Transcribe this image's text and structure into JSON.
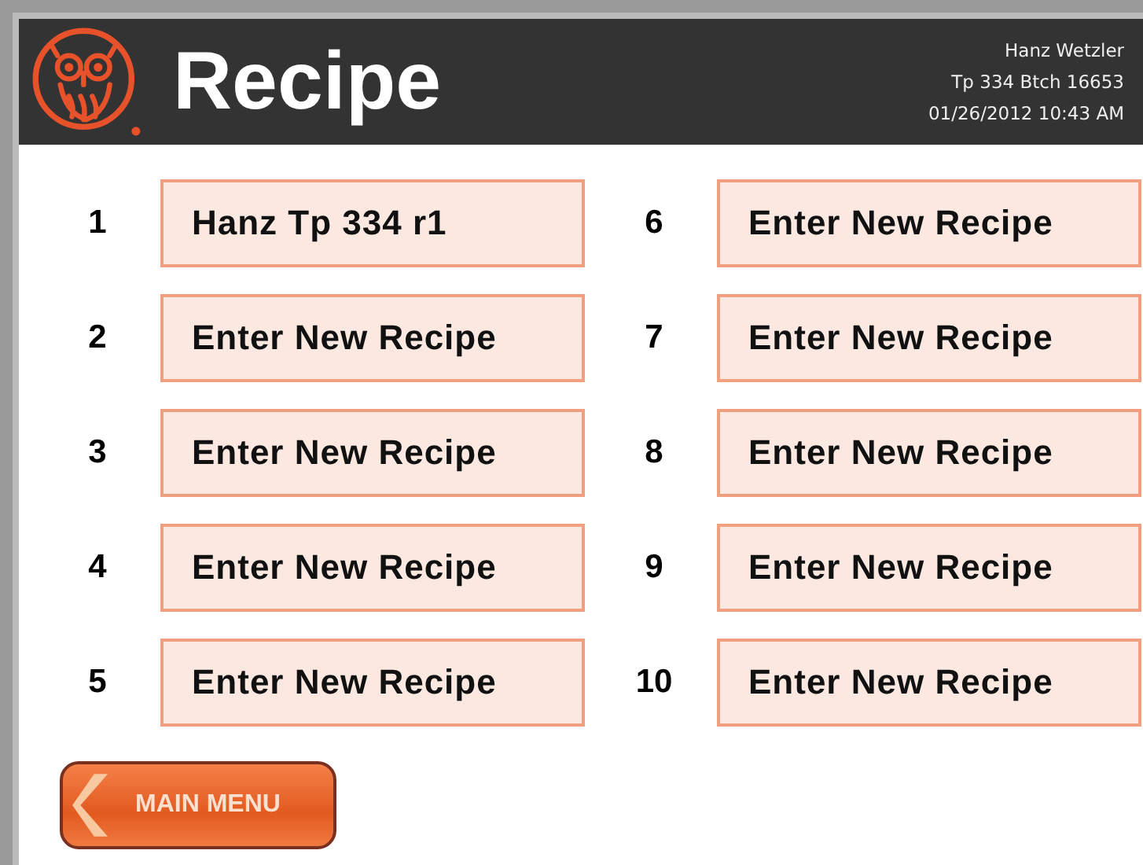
{
  "header": {
    "title": "Recipe",
    "user": "Hanz Wetzler",
    "batch": "Tp 334 Btch 16653",
    "datetime": "01/26/2012 10:43 AM"
  },
  "recipes": [
    {
      "number": "1",
      "label": "Hanz Tp 334 r1"
    },
    {
      "number": "2",
      "label": "Enter New Recipe"
    },
    {
      "number": "3",
      "label": "Enter New Recipe"
    },
    {
      "number": "4",
      "label": "Enter New Recipe"
    },
    {
      "number": "5",
      "label": "Enter New Recipe"
    },
    {
      "number": "6",
      "label": "Enter New Recipe"
    },
    {
      "number": "7",
      "label": "Enter New Recipe"
    },
    {
      "number": "8",
      "label": "Enter New Recipe"
    },
    {
      "number": "9",
      "label": "Enter New Recipe"
    },
    {
      "number": "10",
      "label": "Enter New Recipe"
    }
  ],
  "main_menu_button": "MAIN MENU"
}
